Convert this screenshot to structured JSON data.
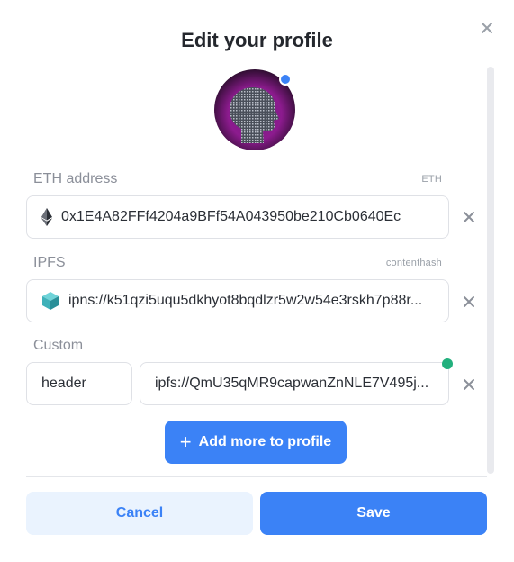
{
  "dialog": {
    "title": "Edit your profile",
    "close_icon": "close-icon"
  },
  "avatar": {
    "description_icon": "avatar-head-icon",
    "status_color": "#3b82f6"
  },
  "records": [
    {
      "label": "ETH address",
      "hint": "ETH",
      "icon": "ethereum-icon",
      "value": "0x1E4A82FFf4204a9BFf54A043950be210Cb0640Ec"
    },
    {
      "label": "IPFS",
      "hint": "contenthash",
      "icon": "ipfs-cube-icon",
      "value": "ipns://k51qzi5uqu5dkhyot8bqdlzr5w2w54e3rskh7p88r..."
    },
    {
      "label": "Custom",
      "key": "header",
      "value": "ipfs://QmU35qMR9capwanZnNLE7V495j...",
      "status_color": "#22b07d"
    }
  ],
  "actions": {
    "add_more": "Add more to profile",
    "cancel": "Cancel",
    "save": "Save"
  },
  "colors": {
    "accent": "#3b82f6",
    "accent_light": "#eaf3fe",
    "success": "#22b07d"
  }
}
